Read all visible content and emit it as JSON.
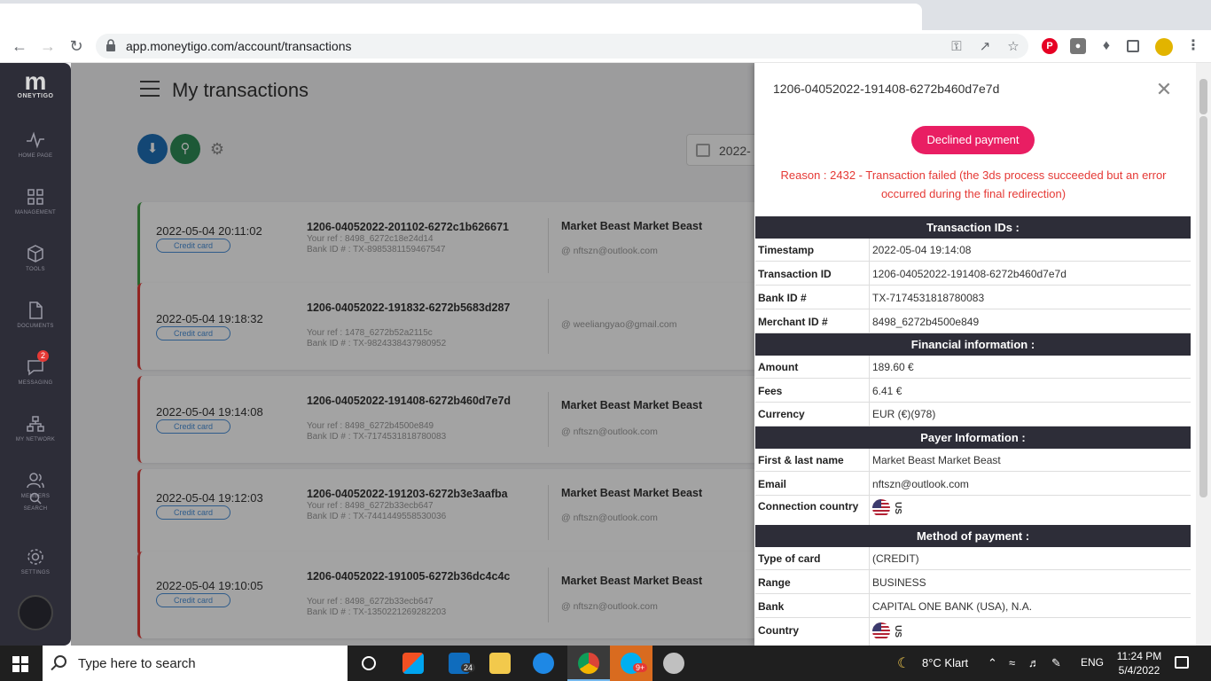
{
  "browser": {
    "url": "app.moneytigo.com/account/transactions"
  },
  "sidebar": {
    "logo_letter": "m",
    "logo_text": "ONEYTIGO",
    "items": [
      {
        "label": "HOME PAGE",
        "icon": "activity-icon"
      },
      {
        "label": "MANAGEMENT",
        "icon": "grid-icon"
      },
      {
        "label": "TOOLS",
        "icon": "cube-icon"
      },
      {
        "label": "DOCUMENTS",
        "icon": "document-icon"
      },
      {
        "label": "MESSAGING",
        "icon": "chat-icon",
        "badge": "2"
      },
      {
        "label": "MY NETWORK",
        "icon": "network-icon"
      },
      {
        "label": "MEMBERS",
        "icon": "users-icon"
      },
      {
        "label": "SEARCH",
        "icon": "search-icon"
      },
      {
        "label": "SETTINGS",
        "icon": "gear-icon"
      }
    ]
  },
  "main": {
    "title": "My transactions",
    "date_filter": "2022-",
    "transactions": [
      {
        "date": "2022-05-04 20:11:02",
        "method": "Credit card",
        "id": "1206-04052022-201102-6272c1b626671",
        "ref": "Your ref : 8498_6272c18e24d14",
        "bank": "Bank ID # : TX-8985381159467547",
        "merchant": "Market Beast Market Beast",
        "email": "@ nftszn@outlook.com",
        "status": "ok"
      },
      {
        "date": "2022-05-04 19:18:32",
        "method": "Credit card",
        "id": "1206-04052022-191832-6272b5683d287",
        "ref": "Your ref : 1478_6272b52a2115c",
        "bank": "Bank ID # : TX-9824338437980952",
        "merchant": "",
        "email": "@ weeliangyao@gmail.com",
        "status": "declined"
      },
      {
        "date": "2022-05-04 19:14:08",
        "method": "Credit card",
        "id": "1206-04052022-191408-6272b460d7e7d",
        "ref": "Your ref : 8498_6272b4500e849",
        "bank": "Bank ID # : TX-7174531818780083",
        "merchant": "Market Beast Market Beast",
        "email": "@ nftszn@outlook.com",
        "status": "declined"
      },
      {
        "date": "2022-05-04 19:12:03",
        "method": "Credit card",
        "id": "1206-04052022-191203-6272b3e3aafba",
        "ref": "Your ref : 8498_6272b33ecb647",
        "bank": "Bank ID # : TX-7441449558530036",
        "merchant": "Market Beast Market Beast",
        "email": "@ nftszn@outlook.com",
        "status": "declined"
      },
      {
        "date": "2022-05-04 19:10:05",
        "method": "Credit card",
        "id": "1206-04052022-191005-6272b36dc4c4c",
        "ref": "Your ref : 8498_6272b33ecb647",
        "bank": "Bank ID # : TX-1350221269282203",
        "merchant": "Market Beast Market Beast",
        "email": "@ nftszn@outlook.com",
        "status": "declined"
      }
    ]
  },
  "drawer": {
    "title": "1206-04052022-191408-6272b460d7e7d",
    "status": "Declined payment",
    "reason_line1": "Reason : 2432 - Transaction failed (the 3ds process succeeded but an error",
    "reason_line2": "occurred during the final redirection)",
    "sections": {
      "ids": "Transaction IDs :",
      "financial": "Financial information :",
      "payer": "Payer Information :",
      "method": "Method of payment :"
    },
    "rows": {
      "timestamp": {
        "k": "Timestamp",
        "v": "2022-05-04 19:14:08"
      },
      "transaction_id": {
        "k": "Transaction ID",
        "v": "1206-04052022-191408-6272b460d7e7d"
      },
      "bank_id": {
        "k": "Bank ID #",
        "v": "TX-7174531818780083"
      },
      "merchant_id": {
        "k": "Merchant ID #",
        "v": "8498_6272b4500e849"
      },
      "amount": {
        "k": "Amount",
        "v": "189.60 €"
      },
      "fees": {
        "k": "Fees",
        "v": "6.41 €"
      },
      "currency": {
        "k": "Currency",
        "v": "EUR (€)(978)"
      },
      "name": {
        "k": "First & last name",
        "v": "Market Beast Market Beast"
      },
      "email": {
        "k": "Email",
        "v": "nftszn@outlook.com"
      },
      "connection_country": {
        "k": "Connection country",
        "v": "US"
      },
      "card_type": {
        "k": "Type of card",
        "v": "(CREDIT)"
      },
      "range": {
        "k": "Range",
        "v": "BUSINESS"
      },
      "bank": {
        "k": "Bank",
        "v": "CAPITAL ONE BANK (USA), N.A."
      },
      "country": {
        "k": "Country",
        "v": "US"
      }
    }
  },
  "taskbar": {
    "search_placeholder": "Type here to search",
    "mail_badge": "24",
    "skype_badge": "9+",
    "weather": "8°C  Klart",
    "lang": "ENG",
    "time": "11:24 PM",
    "date": "5/4/2022"
  },
  "colors": {
    "sidebar_bg": "#2d2d38",
    "declined_pill": "#e91e63",
    "reason_text": "#e53935",
    "download_btn": "#1e6fb8",
    "search_btn": "#2e8b57"
  }
}
